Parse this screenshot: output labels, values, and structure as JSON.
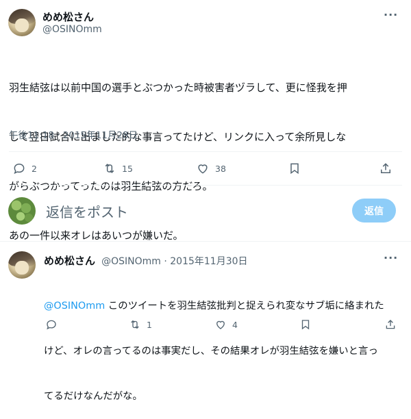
{
  "main_tweet": {
    "display_name": "めめ松さん",
    "handle": "@OSINOmm",
    "more_icon": "more-dots-icon",
    "text_lines": [
      "羽生結弦は以前中国の選手とぶつかった時被害者ヅラして、更に怪我を押",
      "して翌日試合に出ました的な事言ってたけど、リンクに入って余所見しな",
      "がらぶつかってったのは羽生結弦の方だろ。",
      "あの一件以来オレはあいつが嫌いだ。"
    ],
    "timestamp": "午後11:18 · 2015年11月28日",
    "actions": {
      "reply_count": "2",
      "retweet_count": "15",
      "like_count": "38"
    }
  },
  "composer": {
    "placeholder": "返信をポスト",
    "button_label": "返信"
  },
  "reply_tweet": {
    "display_name": "めめ松さん",
    "handle_and_date": "@OSINOmm · 2015年11月30日",
    "mention": "@OSINOmm",
    "text_line1_rest": " このツイートを羽生結弦批判と捉えられ変なサブ垢に絡まれた",
    "text_line2": "けど、オレの言ってるのは事実だし、その結果オレが羽生結弦を嫌いと言っ",
    "text_line3": "てるだけなんだがな。",
    "actions": {
      "retweet_count": "1",
      "like_count": "4"
    }
  },
  "colors": {
    "accent": "#1d9bf0",
    "reply_button": "#8ecdf8",
    "secondary_text": "#536471"
  }
}
